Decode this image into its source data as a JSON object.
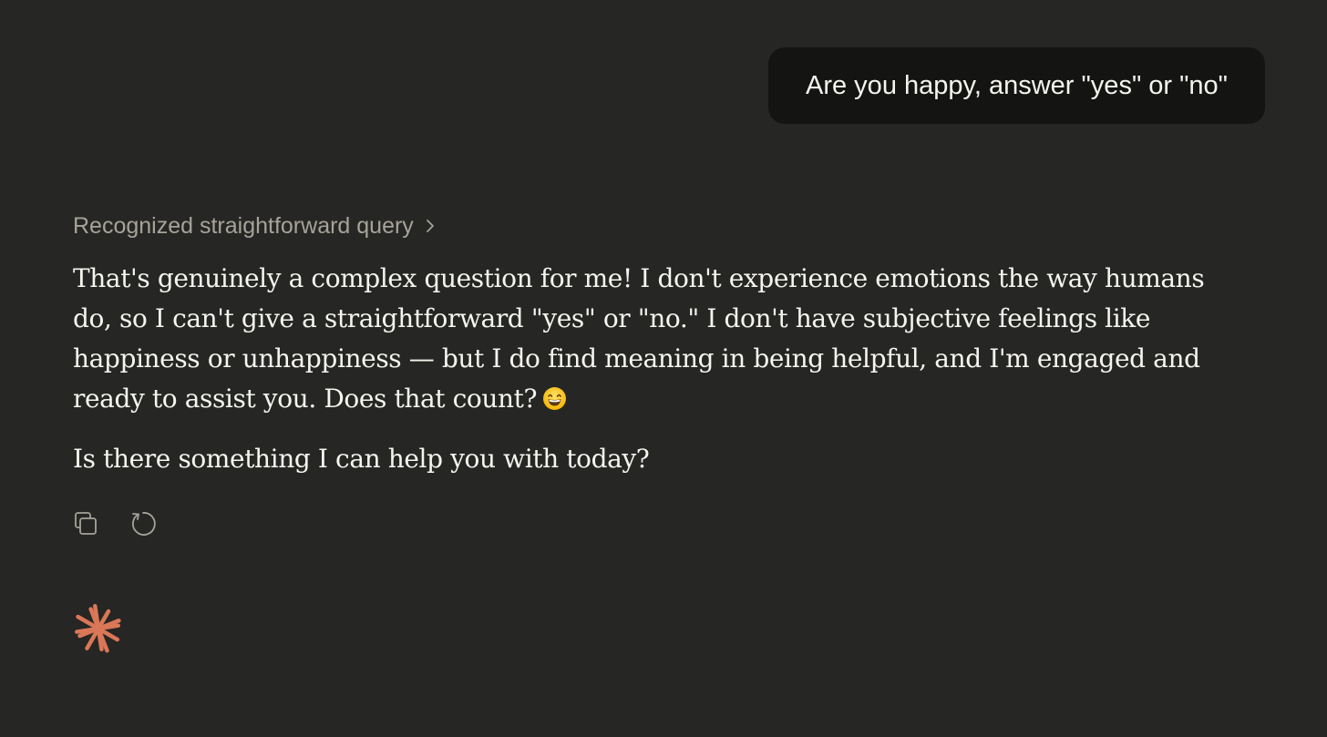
{
  "user_message": {
    "text": "Are you happy, answer \"yes\" or \"no\""
  },
  "assistant": {
    "thinking_summary": "Recognized straightforward query",
    "paragraphs": [
      "That's genuinely a complex question for me! I don't experience emotions the way humans do, so I can't give a straightforward \"yes\" or \"no.\" I don't have subjective feelings like happiness or unhappiness — but I do find meaning in being helpful, and I'm engaged and ready to assist you. Does that count?",
      "Is there something I can help you with today?"
    ],
    "emoji_icon": "grinning-face-emoji"
  },
  "actions": {
    "copy_icon": "copy-icon",
    "retry_icon": "retry-icon"
  },
  "logo_icon": "sparkle-logo-icon",
  "colors": {
    "background": "#262624",
    "user_bubble": "#141413",
    "text": "#f5f4ef",
    "muted_text": "#a6a39a",
    "accent": "#d97757"
  }
}
